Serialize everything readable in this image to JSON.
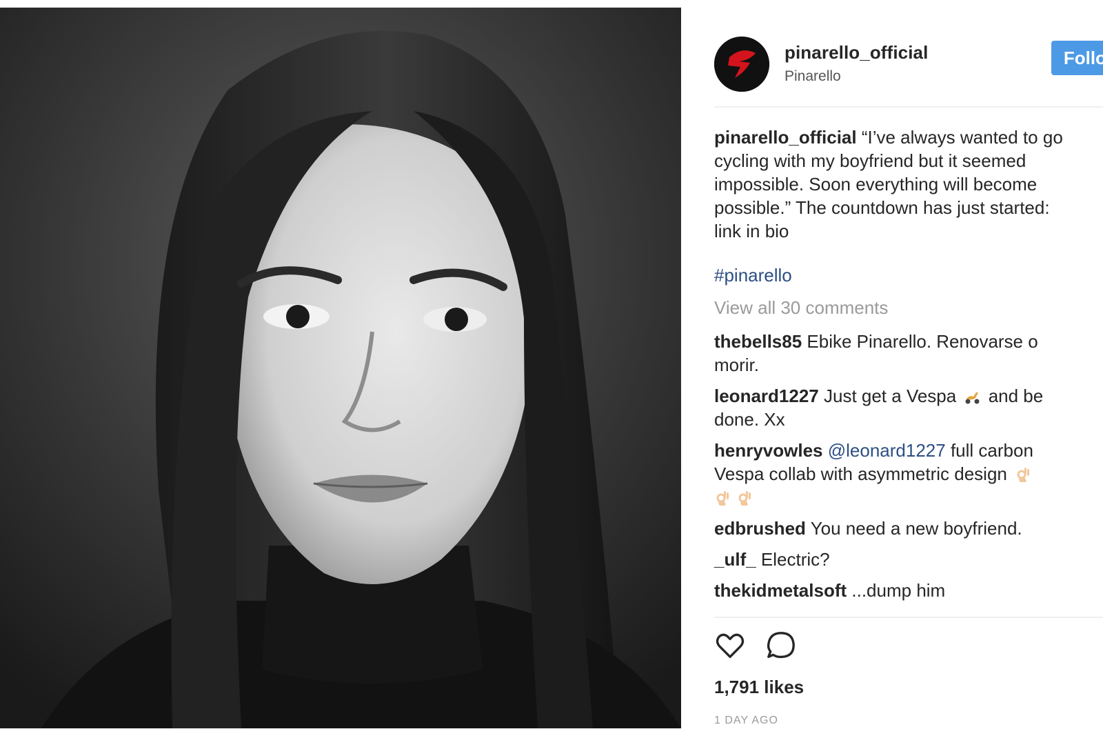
{
  "post": {
    "username": "pinarello_official",
    "full_name": "Pinarello",
    "follow_label": "Follow",
    "caption": {
      "username": "pinarello_official",
      "text": "“I’ve always wanted to go cycling with my boyfriend but it seemed impossible. Soon everything will become possible.” The countdown has just started: link in bio"
    },
    "hashtag": "#pinarello",
    "view_all_comments": "View all 30 comments",
    "comments": [
      {
        "user": "thebells85",
        "text": "Ebike Pinarello. Renovarse o morir."
      },
      {
        "user": "leonard1227",
        "text_before": "Just get a Vespa",
        "emoji": "scooter-emoji",
        "text_after": "and be done. Xx"
      },
      {
        "user": "henryvowles",
        "mention": "@leonard1227",
        "text": "full carbon Vespa collab with asymmetric design",
        "emoji": "ok-hand-emoji"
      },
      {
        "user": "edbrushed",
        "text": "You need a new boyfriend."
      },
      {
        "user": "_ulf_",
        "text": "Electric?"
      },
      {
        "user": "thekidmetalsoft",
        "text": "...dump him"
      }
    ],
    "likes": "1,791 likes",
    "timestamp": "1 DAY AGO",
    "icons": {
      "like": "heart-icon",
      "comment": "comment-bubble-icon",
      "avatar": "pinarello-logo"
    },
    "colors": {
      "follow_button": "#4c9ae6",
      "hashtag": "#2c4f83",
      "muted_text": "#9a9a9a",
      "logo_red": "#d4141c"
    }
  }
}
